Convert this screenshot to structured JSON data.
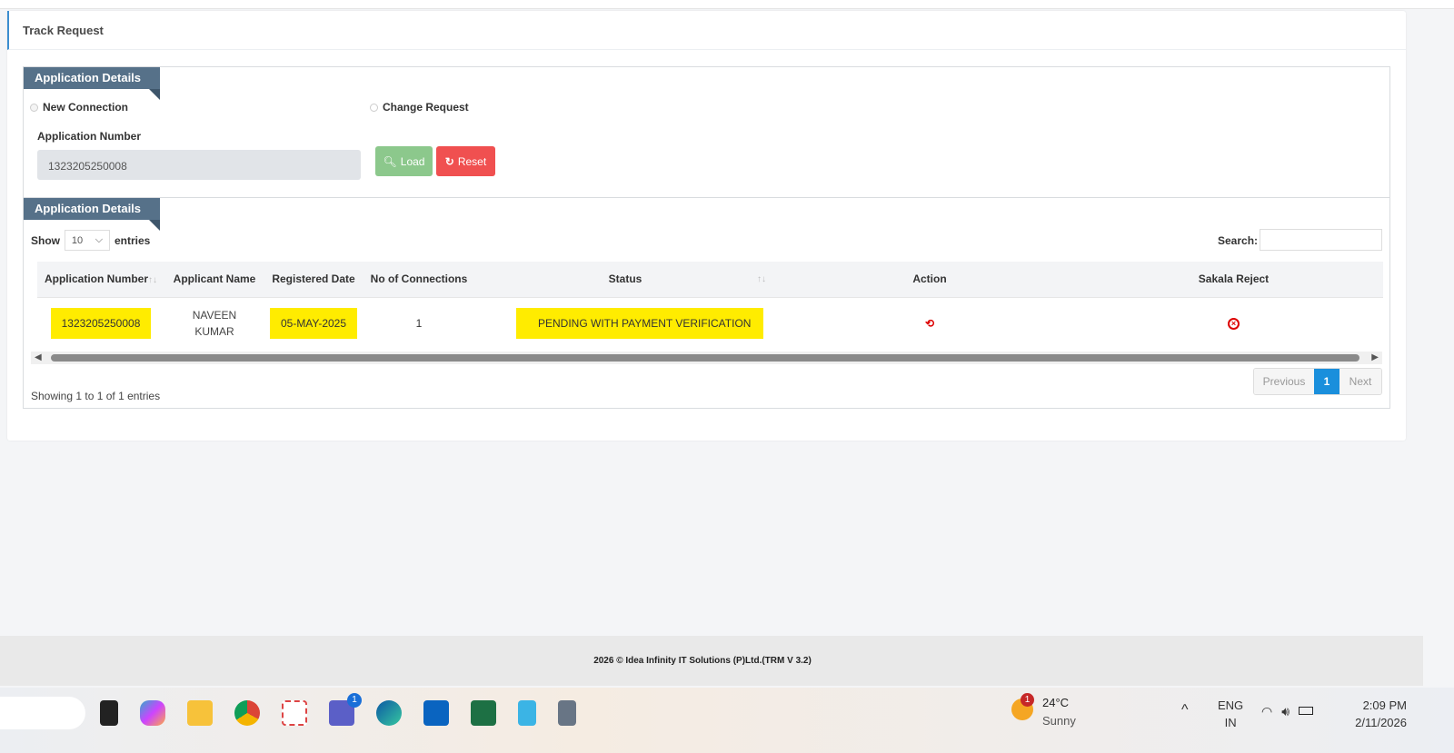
{
  "page": {
    "title": "Track Request"
  },
  "search_panel": {
    "tab": "Application Details",
    "radio_new": "New Connection",
    "radio_change": "Change Request",
    "app_number_label": "Application Number",
    "app_number_value": "1323205250008",
    "load": "Load",
    "reset": "Reset"
  },
  "results_panel": {
    "tab": "Application Details",
    "show": "Show",
    "entries_value": "10",
    "entries": "entries",
    "search_label": "Search:",
    "search_value": "",
    "columns": [
      "Application Number",
      "Applicant Name",
      "Registered Date",
      "No of Connections",
      "Status",
      "Action",
      "Sakala Reject"
    ],
    "rows": [
      {
        "app_number": "1323205250008",
        "applicant_line1": "NAVEEN",
        "applicant_line2": "KUMAR",
        "registered": "05-MAY-2025",
        "connections": "1",
        "status": "PENDING WITH PAYMENT VERIFICATION"
      }
    ],
    "info": "Showing 1 to 1 of 1 entries",
    "previous": "Previous",
    "page": "1",
    "next": "Next"
  },
  "footer": {
    "text": "2026 © Idea Infinity IT Solutions (P)Ltd.(TRM V 3.2)"
  },
  "taskbar": {
    "weather_badge": "1",
    "temp": "24°C",
    "condition": "Sunny",
    "teams_badge": "1",
    "lang1": "ENG",
    "lang2": "IN",
    "time": "2:09 PM",
    "date": "2/11/2026"
  },
  "colors": {
    "tab": "#567189",
    "load": "#8cc88c",
    "reset": "#f05050",
    "highlight": "#ffec00",
    "page_active": "#1a8fdc"
  }
}
